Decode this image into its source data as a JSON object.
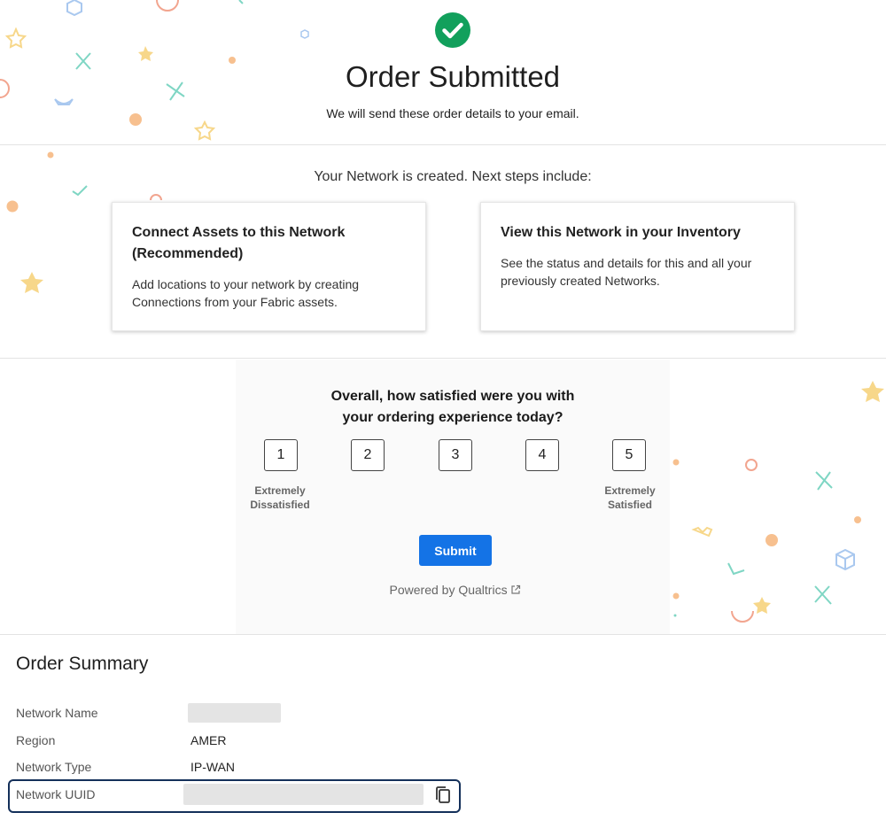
{
  "header": {
    "title": "Order Submitted",
    "subtitle": "We will send these order details to your email."
  },
  "next_steps": {
    "heading": "Your Network is created. Next steps include:",
    "cards": [
      {
        "title": "Connect Assets to this Network (Recommended)",
        "description": "Add locations to your network by creating Connections from your Fabric assets."
      },
      {
        "title": "View this Network in your Inventory",
        "description": "See the status and details for this and all your previously created Networks."
      }
    ]
  },
  "survey": {
    "question": "Overall, how satisfied were you with your ordering experience today?",
    "ratings": [
      "1",
      "2",
      "3",
      "4",
      "5"
    ],
    "low_label": "Extremely Dissatisfied",
    "high_label": "Extremely Satisfied",
    "submit_label": "Submit",
    "powered_by": "Powered by Qualtrics",
    "submit_color": "#1473e6"
  },
  "order_summary": {
    "title": "Order Summary",
    "rows": [
      {
        "label": "Network Name",
        "value": ""
      },
      {
        "label": "Region",
        "value": "AMER"
      },
      {
        "label": "Network Type",
        "value": "IP-WAN"
      },
      {
        "label": "Network UUID",
        "value": ""
      }
    ]
  },
  "icons": {
    "success": "check-circle-icon",
    "external": "external-link-icon",
    "copy": "copy-icon"
  },
  "colors": {
    "success_green": "#12a05c",
    "highlight_border": "#14305a"
  }
}
